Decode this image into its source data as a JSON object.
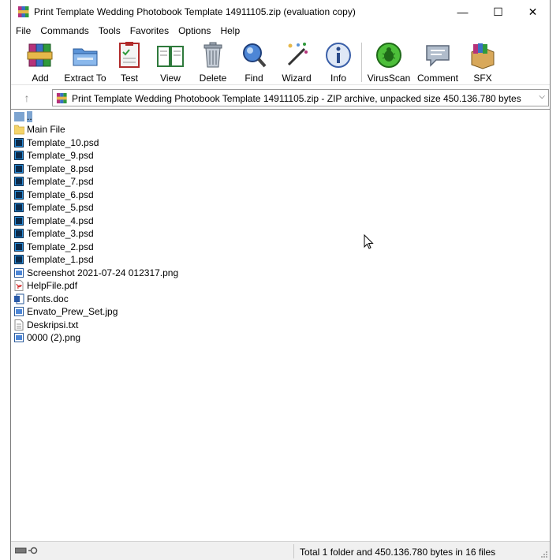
{
  "window": {
    "title": "Print Template Wedding Photobook Template 14911105.zip (evaluation copy)",
    "minimize_glyph": "—",
    "maximize_glyph": "☐",
    "close_glyph": "✕"
  },
  "menu": [
    "File",
    "Commands",
    "Tools",
    "Favorites",
    "Options",
    "Help"
  ],
  "toolbar": {
    "add": "Add",
    "extract_to": "Extract To",
    "test": "Test",
    "view": "View",
    "delete": "Delete",
    "find": "Find",
    "wizard": "Wizard",
    "info": "Info",
    "virusscan": "VirusScan",
    "comment": "Comment",
    "sfx": "SFX"
  },
  "address": {
    "up_glyph": "↑",
    "path": "Print Template Wedding Photobook Template 14911105.zip - ZIP archive, unpacked size 450.136.780 bytes",
    "dropdown_glyph": "⌵"
  },
  "files": [
    {
      "name": "..",
      "icon": "parent-folder-icon"
    },
    {
      "name": "Main File",
      "icon": "folder-icon"
    },
    {
      "name": "Template_10.psd",
      "icon": "psd-icon"
    },
    {
      "name": "Template_9.psd",
      "icon": "psd-icon"
    },
    {
      "name": "Template_8.psd",
      "icon": "psd-icon"
    },
    {
      "name": "Template_7.psd",
      "icon": "psd-icon"
    },
    {
      "name": "Template_6.psd",
      "icon": "psd-icon"
    },
    {
      "name": "Template_5.psd",
      "icon": "psd-icon"
    },
    {
      "name": "Template_4.psd",
      "icon": "psd-icon"
    },
    {
      "name": "Template_3.psd",
      "icon": "psd-icon"
    },
    {
      "name": "Template_2.psd",
      "icon": "psd-icon"
    },
    {
      "name": "Template_1.psd",
      "icon": "psd-icon"
    },
    {
      "name": "Screenshot 2021-07-24 012317.png",
      "icon": "image-icon"
    },
    {
      "name": "HelpFile.pdf",
      "icon": "pdf-icon"
    },
    {
      "name": "Fonts.doc",
      "icon": "word-icon"
    },
    {
      "name": "Envato_Prew_Set.jpg",
      "icon": "image-icon"
    },
    {
      "name": "Deskripsi.txt",
      "icon": "text-file-icon"
    },
    {
      "name": "0000 (2).png",
      "icon": "image-icon"
    }
  ],
  "status": {
    "summary": "Total 1 folder and 450.136.780 bytes in 16 files"
  }
}
